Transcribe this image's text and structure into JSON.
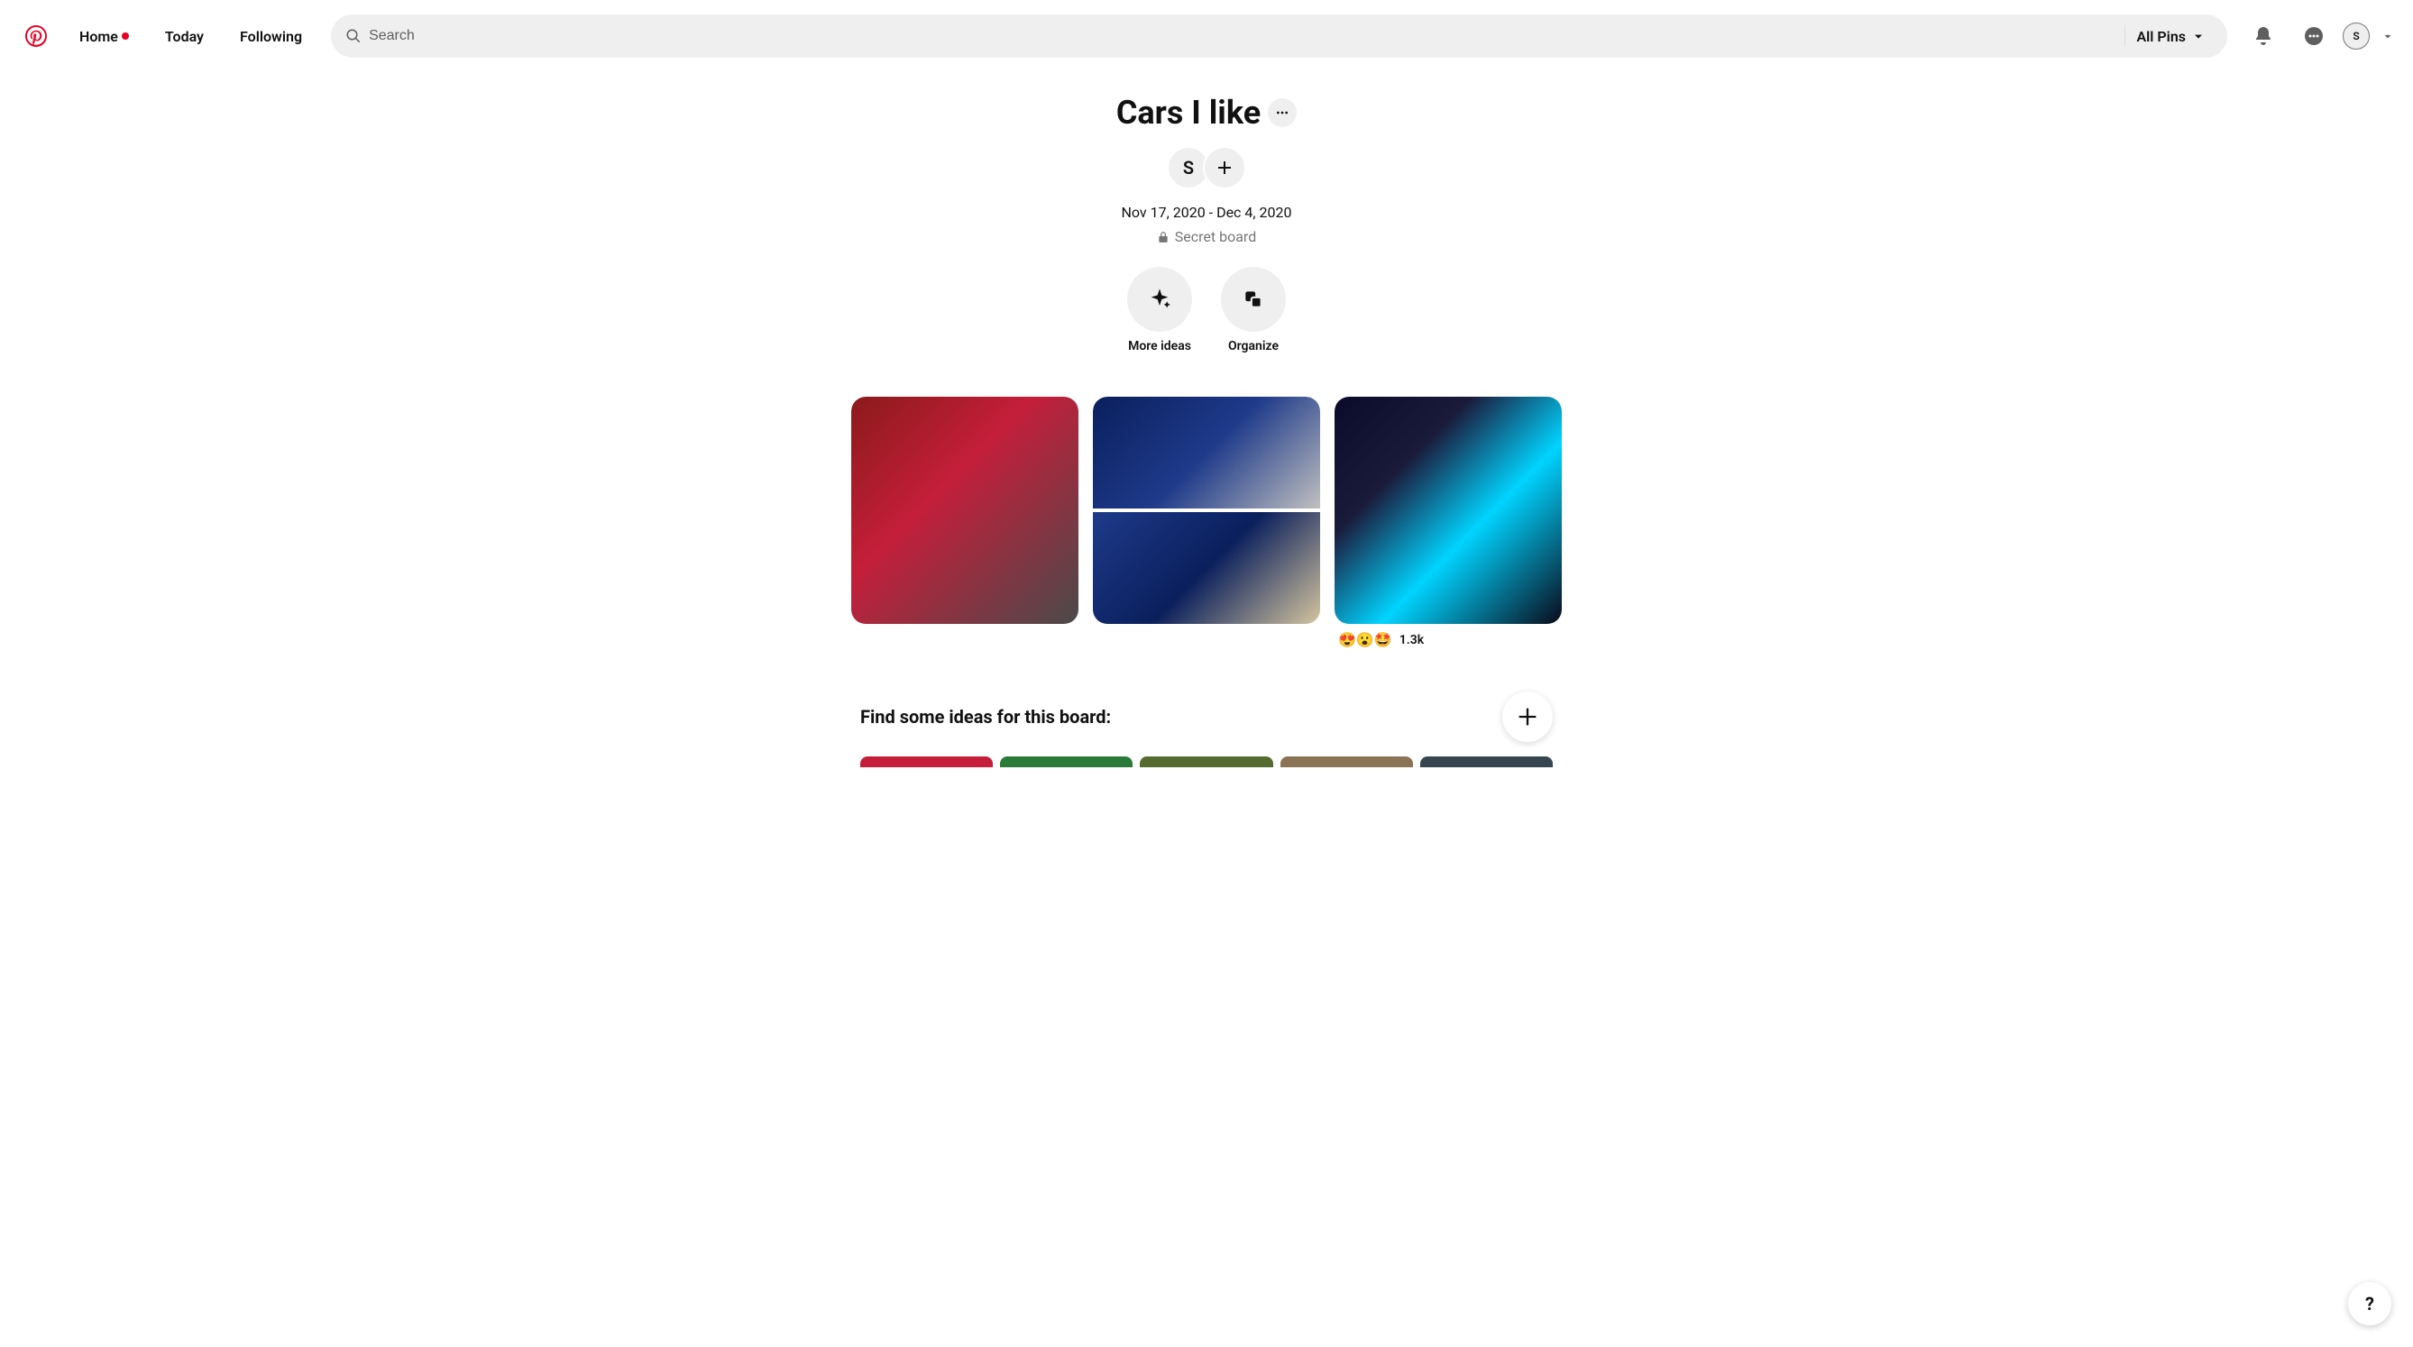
{
  "header": {
    "nav": {
      "home": "Home",
      "today": "Today",
      "following": "Following"
    },
    "search": {
      "placeholder": "Search",
      "filter": "All Pins"
    },
    "avatar_initial": "S"
  },
  "board": {
    "title": "Cars I like",
    "owner_initial": "S",
    "date_range": "Nov 17, 2020 - Dec 4, 2020",
    "secret_label": "Secret board"
  },
  "actions": {
    "more_ideas": "More ideas",
    "organize": "Organize"
  },
  "pins": [
    {
      "id": "pin-red-bugatti"
    },
    {
      "id": "pin-blue-corvette"
    },
    {
      "id": "pin-neon-concept",
      "reactions": "😍😮🤩",
      "reaction_count": "1.3k"
    }
  ],
  "ideas": {
    "title": "Find some ideas for this board:"
  },
  "help": "?"
}
